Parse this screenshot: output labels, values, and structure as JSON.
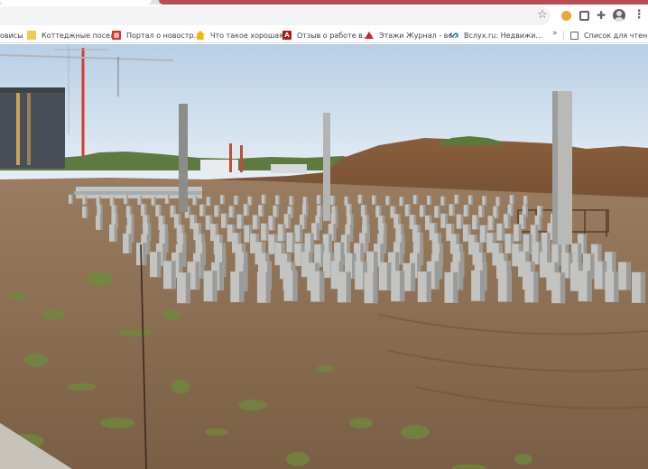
{
  "browser": {
    "bookmarks": [
      {
        "label": "овисы",
        "icon": "none"
      },
      {
        "label": "Коттеджные посел...",
        "icon": "yellow-bookmark-icon"
      },
      {
        "label": "Портал о новостр...",
        "icon": "red-portal-icon"
      },
      {
        "label": "Что такое хорошая...",
        "icon": "house-icon"
      },
      {
        "label": "Отзыв о работе в...",
        "icon": "letter-a-icon"
      },
      {
        "label": "Этажи Журнал - вс...",
        "icon": "roof-icon"
      },
      {
        "label": "Вслух.ru: Недвижи...",
        "icon": "ribbon-icon"
      }
    ],
    "bookmarks_more": "»",
    "reading_list_label": "Список для чтения",
    "toolbar_icons": [
      "star-icon",
      "cookie-extension-icon",
      "box-extension-icon",
      "puzzle-extension-icon",
      "profile-avatar-icon",
      "menu-dots-icon"
    ]
  },
  "photo": {
    "subject": "construction site with rows of concrete piles",
    "colors": {
      "sky_top": "#b8cfe6",
      "sky_bottom": "#e6eef5",
      "soil": "#8a6c50",
      "soil_dark": "#6e5238",
      "pile": "#c3c4c1",
      "pile_shadow": "#9a9b98",
      "grass": "#6f8a3e",
      "building": "#4a4f57",
      "crane": "#d33c2e"
    }
  }
}
